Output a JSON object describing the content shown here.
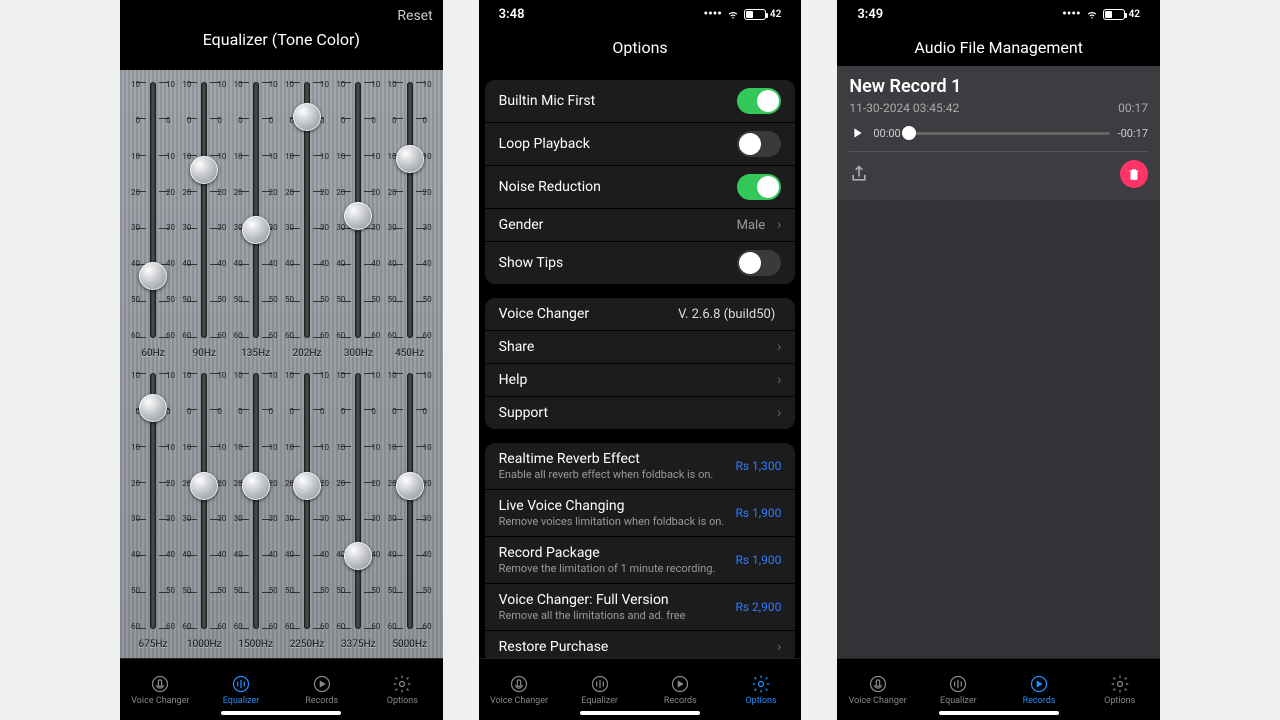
{
  "scaleLabels": [
    "10",
    "0",
    "10",
    "20",
    "30",
    "40",
    "50",
    "60"
  ],
  "panel1": {
    "title": "Equalizer (Tone Color)",
    "reset": "Reset",
    "bandsTop": [
      {
        "hz": "60Hz",
        "val": -45
      },
      {
        "hz": "90Hz",
        "val": -15
      },
      {
        "hz": "135Hz",
        "val": -32
      },
      {
        "hz": "202Hz",
        "val": 0
      },
      {
        "hz": "300Hz",
        "val": -28
      },
      {
        "hz": "450Hz",
        "val": -12
      }
    ],
    "bandsBottom": [
      {
        "hz": "675Hz",
        "val": 0
      },
      {
        "hz": "1000Hz",
        "val": -22
      },
      {
        "hz": "1500Hz",
        "val": -22
      },
      {
        "hz": "2250Hz",
        "val": -22
      },
      {
        "hz": "3375Hz",
        "val": -42
      },
      {
        "hz": "5000Hz",
        "val": -22
      }
    ]
  },
  "panel2": {
    "time": "3:48",
    "battery": "42",
    "title": "Options",
    "section1": [
      {
        "label": "Builtin Mic First",
        "type": "toggle",
        "on": true
      },
      {
        "label": "Loop Playback",
        "type": "toggle",
        "on": false
      },
      {
        "label": "Noise Reduction",
        "type": "toggle",
        "on": true
      },
      {
        "label": "Gender",
        "type": "value",
        "value": "Male"
      },
      {
        "label": "Show Tips",
        "type": "toggle",
        "on": false
      }
    ],
    "section2": [
      {
        "label": "Voice Changer",
        "type": "version",
        "value": "V. 2.6.8 (build50)"
      },
      {
        "label": "Share",
        "type": "chevron"
      },
      {
        "label": "Help",
        "type": "chevron"
      },
      {
        "label": "Support",
        "type": "chevron"
      }
    ],
    "section3": [
      {
        "label": "Realtime Reverb Effect",
        "sub": "Enable all reverb effect when foldback is on.",
        "price": "Rs 1,300"
      },
      {
        "label": "Live Voice Changing",
        "sub": "Remove voices limitation when foldback is on.",
        "price": "Rs 1,900"
      },
      {
        "label": "Record Package",
        "sub": "Remove the limitation of 1 minute recording.",
        "price": "Rs 1,900"
      },
      {
        "label": "Voice Changer: Full Version",
        "sub": "Remove all the limitations and ad. free",
        "price": "Rs 2,900"
      }
    ],
    "restore": "Restore Purchase"
  },
  "panel3": {
    "time": "3:49",
    "battery": "42",
    "title": "Audio File Management",
    "recTitle": "New Record 1",
    "recDate": "11-30-2024 03:45:42",
    "recDur": "00:17",
    "curTime": "00:00",
    "remTime": "-00:17"
  },
  "tabs": [
    {
      "label": "Voice Changer",
      "name": "voice-changer-tab"
    },
    {
      "label": "Equalizer",
      "name": "equalizer-tab"
    },
    {
      "label": "Records",
      "name": "records-tab"
    },
    {
      "label": "Options",
      "name": "options-tab"
    }
  ]
}
